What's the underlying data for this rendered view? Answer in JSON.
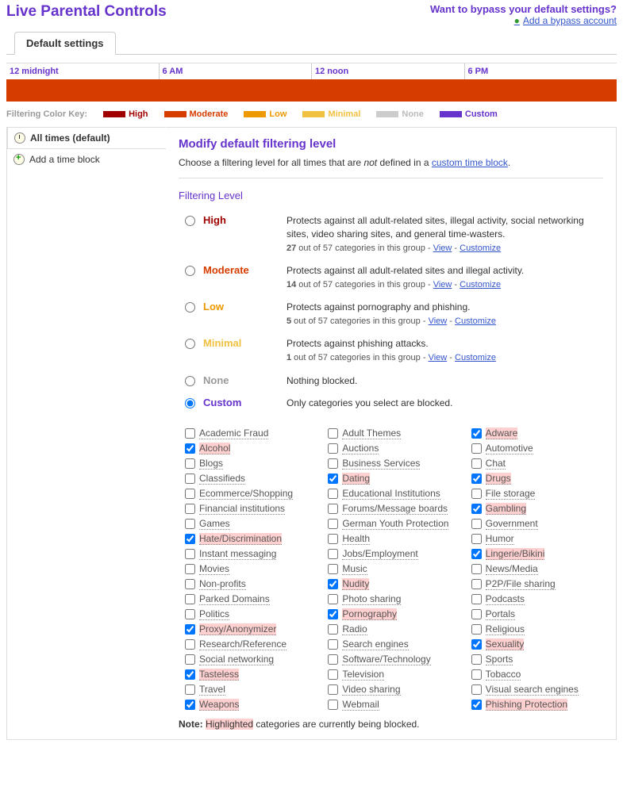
{
  "header": {
    "title": "Live Parental Controls",
    "bypass_q": "Want to bypass your default settings?",
    "bypass_link": "Add a bypass account"
  },
  "tabs": {
    "default": "Default settings"
  },
  "schedule": {
    "t0": "12 midnight",
    "t1": "6 AM",
    "t2": "12 noon",
    "t3": "6 PM"
  },
  "key": {
    "label": "Filtering Color Key:",
    "high": "High",
    "moderate": "Moderate",
    "low": "Low",
    "minimal": "Minimal",
    "none": "None",
    "custom": "Custom"
  },
  "sidebar": {
    "all_times": "All times (default)",
    "add_block": "Add a time block"
  },
  "content": {
    "heading": "Modify default filtering level",
    "subtitle_pre": "Choose a filtering level for all times that are ",
    "subtitle_not": "not",
    "subtitle_post": " defined in a ",
    "subtitle_link": "custom time block",
    "section": "Filtering Level",
    "view": "View",
    "customize": "Customize",
    "note_pre": "Note: ",
    "note_hl": "Highlighted",
    "note_post": " categories are currently being blocked."
  },
  "levels": [
    {
      "key": "high",
      "name": "High",
      "desc": "Protects against all adult-related sites, illegal activity, social networking sites, video sharing sites, and general time-wasters.",
      "count": "27",
      "total": "57"
    },
    {
      "key": "moderate",
      "name": "Moderate",
      "desc": "Protects against all adult-related sites and illegal activity.",
      "count": "14",
      "total": "57"
    },
    {
      "key": "low",
      "name": "Low",
      "desc": "Protects against pornography and phishing.",
      "count": "5",
      "total": "57"
    },
    {
      "key": "minimal",
      "name": "Minimal",
      "desc": "Protects against phishing attacks.",
      "count": "1",
      "total": "57"
    },
    {
      "key": "none",
      "name": "None",
      "desc": "Nothing blocked."
    },
    {
      "key": "custom",
      "name": "Custom",
      "desc": "Only categories you select are blocked.",
      "selected": true
    }
  ],
  "categories": [
    {
      "n": "Academic Fraud",
      "c": false,
      "h": false
    },
    {
      "n": "Adult Themes",
      "c": false,
      "h": false
    },
    {
      "n": "Adware",
      "c": true,
      "h": true
    },
    {
      "n": "Alcohol",
      "c": true,
      "h": true
    },
    {
      "n": "Auctions",
      "c": false,
      "h": false
    },
    {
      "n": "Automotive",
      "c": false,
      "h": false
    },
    {
      "n": "Blogs",
      "c": false,
      "h": false
    },
    {
      "n": "Business Services",
      "c": false,
      "h": false
    },
    {
      "n": "Chat",
      "c": false,
      "h": false
    },
    {
      "n": "Classifieds",
      "c": false,
      "h": false
    },
    {
      "n": "Dating",
      "c": true,
      "h": true
    },
    {
      "n": "Drugs",
      "c": true,
      "h": true
    },
    {
      "n": "Ecommerce/Shopping",
      "c": false,
      "h": false
    },
    {
      "n": "Educational Institutions",
      "c": false,
      "h": false
    },
    {
      "n": "File storage",
      "c": false,
      "h": false
    },
    {
      "n": "Financial institutions",
      "c": false,
      "h": false
    },
    {
      "n": "Forums/Message boards",
      "c": false,
      "h": false
    },
    {
      "n": "Gambling",
      "c": true,
      "h": true
    },
    {
      "n": "Games",
      "c": false,
      "h": false
    },
    {
      "n": "German Youth Protection",
      "c": false,
      "h": false
    },
    {
      "n": "Government",
      "c": false,
      "h": false
    },
    {
      "n": "Hate/Discrimination",
      "c": true,
      "h": true
    },
    {
      "n": "Health",
      "c": false,
      "h": false
    },
    {
      "n": "Humor",
      "c": false,
      "h": false
    },
    {
      "n": "Instant messaging",
      "c": false,
      "h": false
    },
    {
      "n": "Jobs/Employment",
      "c": false,
      "h": false
    },
    {
      "n": "Lingerie/Bikini",
      "c": true,
      "h": true
    },
    {
      "n": "Movies",
      "c": false,
      "h": false
    },
    {
      "n": "Music",
      "c": false,
      "h": false
    },
    {
      "n": "News/Media",
      "c": false,
      "h": false
    },
    {
      "n": "Non-profits",
      "c": false,
      "h": false
    },
    {
      "n": "Nudity",
      "c": true,
      "h": true
    },
    {
      "n": "P2P/File sharing",
      "c": false,
      "h": false
    },
    {
      "n": "Parked Domains",
      "c": false,
      "h": false
    },
    {
      "n": "Photo sharing",
      "c": false,
      "h": false
    },
    {
      "n": "Podcasts",
      "c": false,
      "h": false
    },
    {
      "n": "Politics",
      "c": false,
      "h": false
    },
    {
      "n": "Pornography",
      "c": true,
      "h": true
    },
    {
      "n": "Portals",
      "c": false,
      "h": false
    },
    {
      "n": "Proxy/Anonymizer",
      "c": true,
      "h": true
    },
    {
      "n": "Radio",
      "c": false,
      "h": false
    },
    {
      "n": "Religious",
      "c": false,
      "h": false
    },
    {
      "n": "Research/Reference",
      "c": false,
      "h": false
    },
    {
      "n": "Search engines",
      "c": false,
      "h": false
    },
    {
      "n": "Sexuality",
      "c": true,
      "h": true
    },
    {
      "n": "Social networking",
      "c": false,
      "h": false
    },
    {
      "n": "Software/Technology",
      "c": false,
      "h": false
    },
    {
      "n": "Sports",
      "c": false,
      "h": false
    },
    {
      "n": "Tasteless",
      "c": true,
      "h": true
    },
    {
      "n": "Television",
      "c": false,
      "h": false
    },
    {
      "n": "Tobacco",
      "c": false,
      "h": false
    },
    {
      "n": "Travel",
      "c": false,
      "h": false
    },
    {
      "n": "Video sharing",
      "c": false,
      "h": false
    },
    {
      "n": "Visual search engines",
      "c": false,
      "h": false
    },
    {
      "n": "Weapons",
      "c": true,
      "h": true
    },
    {
      "n": "Webmail",
      "c": false,
      "h": false
    },
    {
      "n": "Phishing Protection",
      "c": true,
      "h": true
    }
  ]
}
